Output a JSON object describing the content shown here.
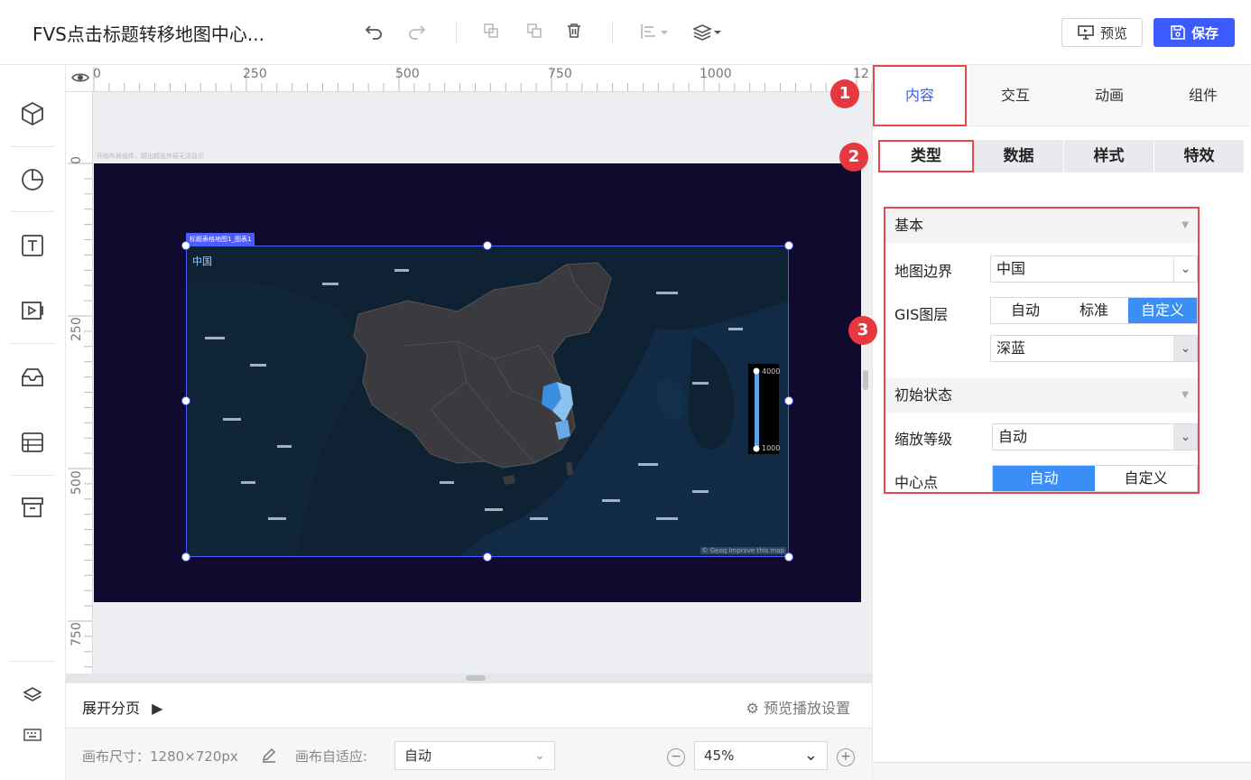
{
  "header": {
    "title": "FVS点击标题转移地图中心...",
    "preview_label": "预览",
    "save_label": "保存"
  },
  "canvas": {
    "ruler_top": [
      "0",
      "250",
      "500",
      "750",
      "1000",
      "12"
    ],
    "ruler_left": [
      "0",
      "250",
      "500",
      "750"
    ],
    "hint": "开始布局组件，超出超出外容无法显示",
    "component_tag": "标题表格地图1_图表1",
    "map_label": "中国",
    "legend_max": "4000",
    "legend_min": "1000",
    "attribution": "© Geoq Improve this map"
  },
  "pagebar": {
    "expand_label": "展开分页",
    "play_settings_label": "预览播放设置"
  },
  "statusbar": {
    "canvas_size_label": "画布尺寸：1280×720px",
    "adapt_label": "画布自适应:",
    "adapt_value": "自动",
    "zoom_value": "45%"
  },
  "panel": {
    "tabs": [
      "内容",
      "交互",
      "动画",
      "组件"
    ],
    "subtabs": [
      "类型",
      "数据",
      "样式",
      "特效"
    ],
    "badges": [
      "1",
      "2",
      "3"
    ],
    "basic": {
      "title": "基本",
      "map_boundary_label": "地图边界",
      "map_boundary_value": "中国",
      "gis_label": "GIS图层",
      "gis_options": [
        "自动",
        "标准",
        "自定义"
      ],
      "gis_custom_value": "深蓝"
    },
    "initial": {
      "title": "初始状态",
      "zoom_label": "缩放等级",
      "zoom_value": "自动",
      "center_label": "中心点",
      "center_options": [
        "自动",
        "自定义"
      ]
    }
  },
  "colors": {
    "accent": "#3b5bff",
    "highlight_red": "#e5484d",
    "segment_active": "#3a8ef6",
    "canvas_bg": "#0f0a2e"
  }
}
